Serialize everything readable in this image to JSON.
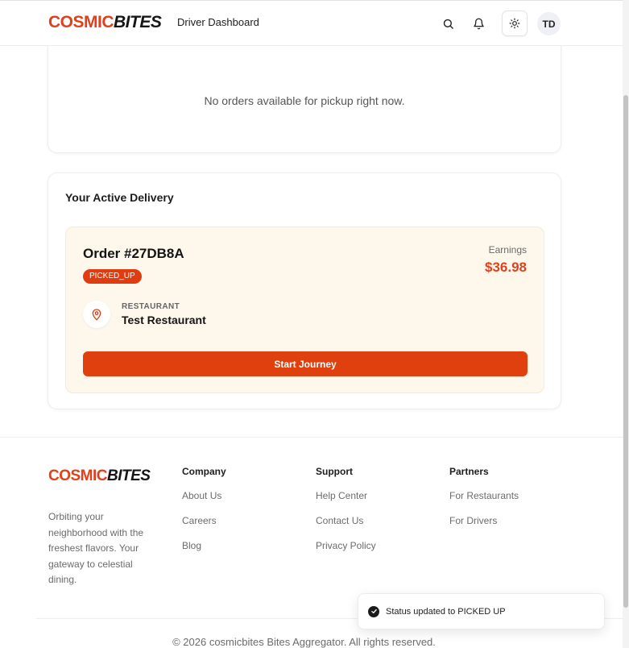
{
  "header": {
    "logo_primary": "COSMIC",
    "logo_secondary": "BITES",
    "nav_title": "Driver Dashboard",
    "icons": [
      "search-icon",
      "bell-icon",
      "sun-icon"
    ],
    "avatar_initials": "TD"
  },
  "available_orders": {
    "empty_message": "No orders available for pickup right now."
  },
  "active_delivery": {
    "section_title": "Your Active Delivery",
    "order_title": "Order #27DB8A",
    "status": "PICKED_UP",
    "earnings_label": "Earnings",
    "earnings_value": "$36.98",
    "restaurant_label": "RESTAURANT",
    "restaurant_name": "Test Restaurant",
    "start_button": "Start Journey"
  },
  "footer": {
    "logo_primary": "COSMIC",
    "logo_secondary": "BITES",
    "tagline": "Orbiting your neighborhood with the freshest flavors. Your gateway to celestial dining.",
    "columns": [
      {
        "title": "Company",
        "links": [
          "About Us",
          "Careers",
          "Blog"
        ]
      },
      {
        "title": "Support",
        "links": [
          "Help Center",
          "Contact Us",
          "Privacy Policy"
        ]
      },
      {
        "title": "Partners",
        "links": [
          "For Restaurants",
          "For Drivers"
        ]
      }
    ],
    "copyright": "© 2026 cosmicbites Bites Aggregator. All rights reserved."
  },
  "toast": {
    "message": "Status updated to PICKED UP"
  },
  "colors": {
    "brand": "#e0401b",
    "order_box_bg": "#fdf7ec",
    "button": "#e0400d"
  }
}
